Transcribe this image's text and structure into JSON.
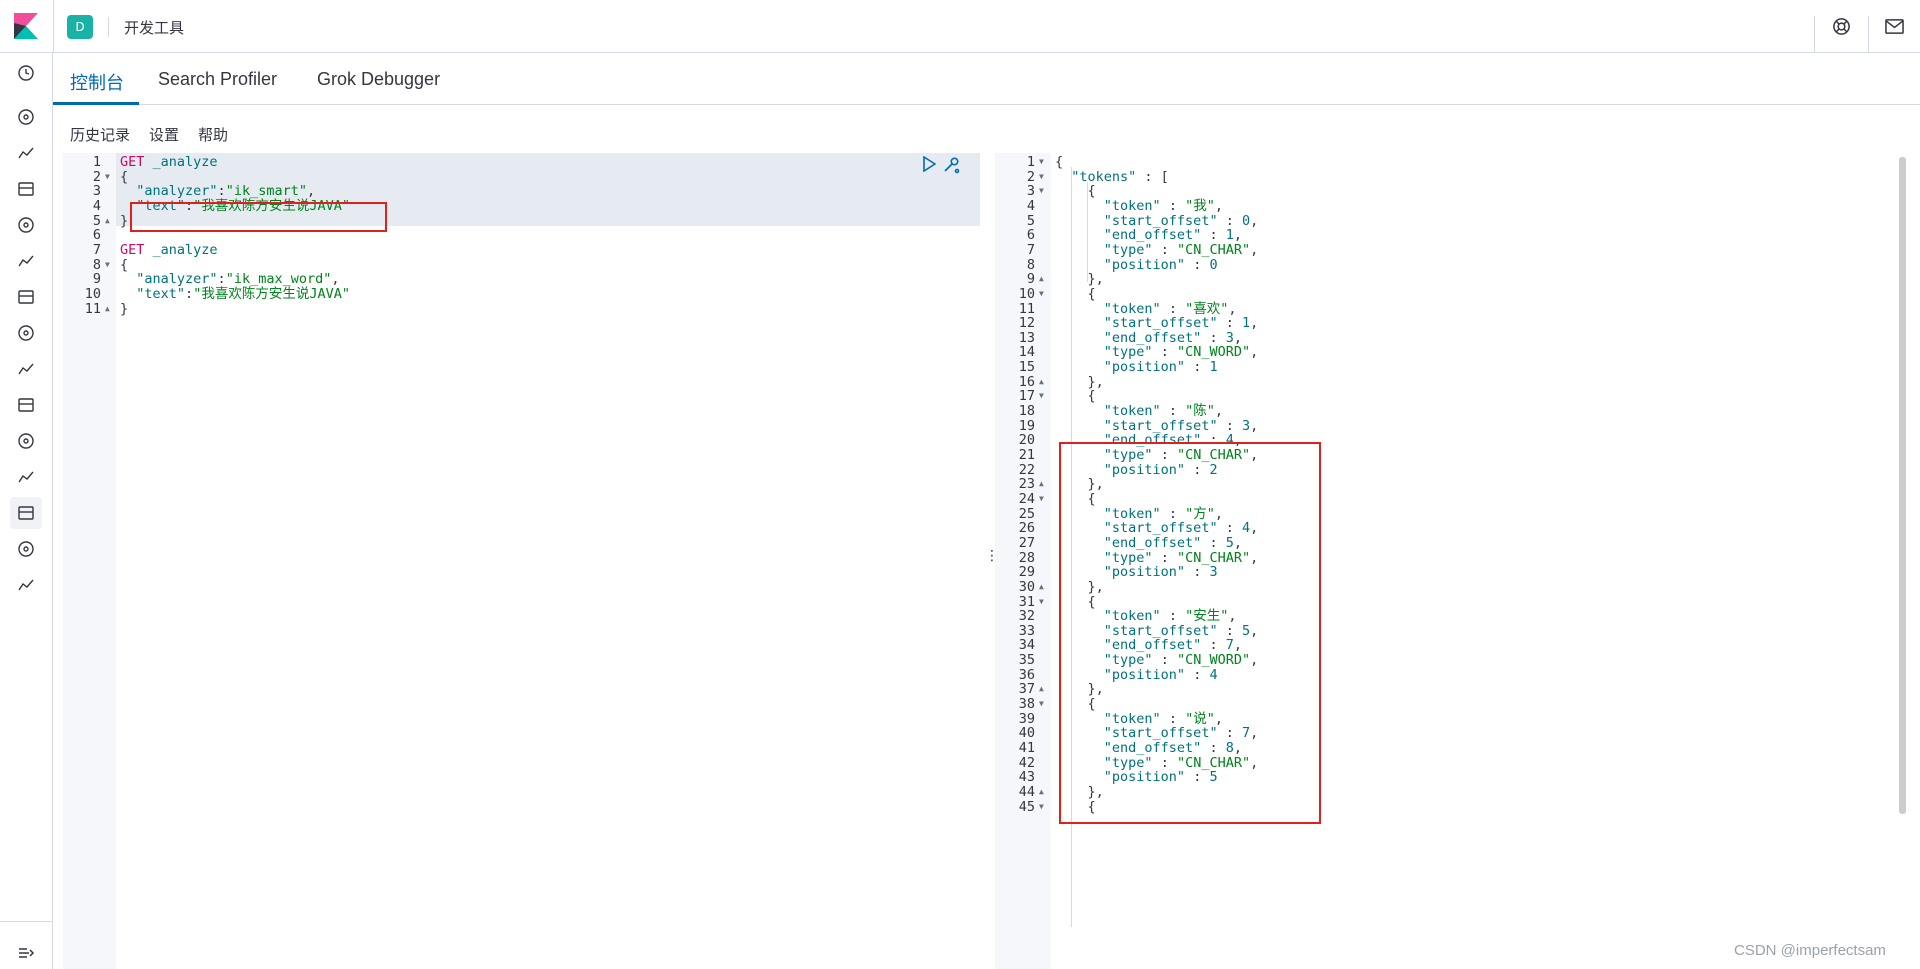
{
  "header": {
    "space_letter": "D",
    "breadcrumb": "开发工具"
  },
  "tabs": [
    {
      "label": "控制台",
      "active": true
    },
    {
      "label": "Search Profiler",
      "active": false
    },
    {
      "label": "Grok Debugger",
      "active": false
    }
  ],
  "toolbar": {
    "history": "历史记录",
    "settings": "设置",
    "help": "帮助"
  },
  "colors": {
    "accent": "#006bb4",
    "space_avatar": "#19b3a6",
    "highlight_box": "#e0201c"
  },
  "nav_icons": [
    "clock-icon",
    "compass-icon",
    "chart-icon",
    "dashboard-icon",
    "canvas-icon",
    "maps-icon",
    "ml-icon",
    "metrics-icon",
    "logs-icon",
    "apm-icon",
    "uptime-icon",
    "siem-icon",
    "devtools-icon",
    "monitoring-icon",
    "management-icon"
  ],
  "request_editor": {
    "lines": [
      "GET _analyze",
      "{",
      "  \"analyzer\":\"ik_smart\",",
      "  \"text\":\"我喜欢陈方安生说JAVA\"",
      "}",
      "",
      "GET _analyze",
      "{",
      "  \"analyzer\":\"ik_max_word\",",
      "  \"text\":\"我喜欢陈方安生说JAVA\"",
      "}"
    ]
  },
  "response_editor": {
    "lines": [
      "{",
      "  \"tokens\" : [",
      "    {",
      "      \"token\" : \"我\",",
      "      \"start_offset\" : 0,",
      "      \"end_offset\" : 1,",
      "      \"type\" : \"CN_CHAR\",",
      "      \"position\" : 0",
      "    },",
      "    {",
      "      \"token\" : \"喜欢\",",
      "      \"start_offset\" : 1,",
      "      \"end_offset\" : 3,",
      "      \"type\" : \"CN_WORD\",",
      "      \"position\" : 1",
      "    },",
      "    {",
      "      \"token\" : \"陈\",",
      "      \"start_offset\" : 3,",
      "      \"end_offset\" : 4,",
      "      \"type\" : \"CN_CHAR\",",
      "      \"position\" : 2",
      "    },",
      "    {",
      "      \"token\" : \"方\",",
      "      \"start_offset\" : 4,",
      "      \"end_offset\" : 5,",
      "      \"type\" : \"CN_CHAR\",",
      "      \"position\" : 3",
      "    },",
      "    {",
      "      \"token\" : \"安生\",",
      "      \"start_offset\" : 5,",
      "      \"end_offset\" : 7,",
      "      \"type\" : \"CN_WORD\",",
      "      \"position\" : 4",
      "    },",
      "    {",
      "      \"token\" : \"说\",",
      "      \"start_offset\" : 7,",
      "      \"end_offset\" : 8,",
      "      \"type\" : \"CN_CHAR\",",
      "      \"position\" : 5",
      "    },",
      "    {"
    ]
  },
  "watermark": "CSDN @imperfectsam"
}
